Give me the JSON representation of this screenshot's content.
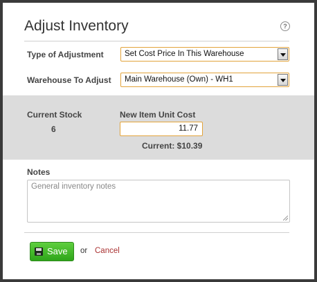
{
  "dialog": {
    "title": "Adjust Inventory",
    "help_icon": "help-circle-icon",
    "help_text": "?"
  },
  "form": {
    "type_label": "Type of Adjustment",
    "type_value": "Set Cost Price In This Warehouse",
    "warehouse_label": "Warehouse To Adjust",
    "warehouse_value": "Main Warehouse (Own) - WH1"
  },
  "stock": {
    "current_label": "Current Stock",
    "current_value": "6",
    "new_cost_label": "New Item Unit Cost",
    "new_cost_value": "11.77",
    "current_cost_text": "Current: $10.39"
  },
  "notes": {
    "label": "Notes",
    "placeholder": "General inventory notes"
  },
  "actions": {
    "save_label": "Save",
    "or_text": "or",
    "cancel_label": "Cancel"
  },
  "colors": {
    "accent_border": "#e2a33a",
    "save_green": "#2ea51a",
    "cancel_red": "#aa3333"
  }
}
